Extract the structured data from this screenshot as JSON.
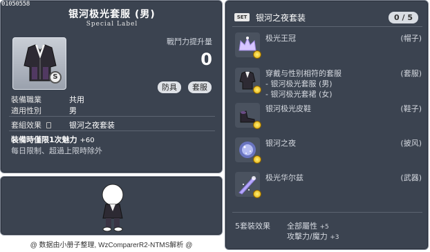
{
  "id_tag": "01050558",
  "item": {
    "title": "银河极光套服 (男)",
    "subtitle": "Special Label",
    "power_label": "戰鬥力提升量",
    "power_value": "0",
    "tags": [
      "防具",
      "套服"
    ],
    "job_label": "裝備職業",
    "job_value": "共用",
    "gender_label": "適用性別",
    "gender_value": "男",
    "set_effect_label": "套組效果",
    "set_effect_value": "银河之夜套装",
    "limit_main": "裝備時僅限1次魅力",
    "limit_plus": "+60",
    "limit_sub": "每日限制、超過上限時除外"
  },
  "caption": "@ 数据由小册子整理, WzComparerR2-NTMS解析 @",
  "set": {
    "badge": "SET",
    "name": "银河之夜套装",
    "count": "0 / 5",
    "pieces": [
      {
        "name": "极光王冠",
        "category": "(帽子)",
        "icon": "crown-icon"
      },
      {
        "name": "穿戴与性别相符的套服",
        "category": "(套服)",
        "sub": [
          "- 银河极光套服 (男)",
          "- 银河极光套裙 (女)"
        ],
        "icon": "suit-icon"
      },
      {
        "name": "银河极光皮鞋",
        "category": "(鞋子)",
        "icon": "shoes-icon"
      },
      {
        "name": "银河之夜",
        "category": "(披风)",
        "icon": "cape-icon"
      },
      {
        "name": "极光华尔兹",
        "category": "(武器)",
        "icon": "weapon-icon"
      }
    ],
    "bonus_label": "5套裝效果",
    "bonus_lines": [
      {
        "text": "全部屬性",
        "plus": "+5"
      },
      {
        "text": "攻擊力/魔力",
        "plus": "+3"
      }
    ]
  }
}
